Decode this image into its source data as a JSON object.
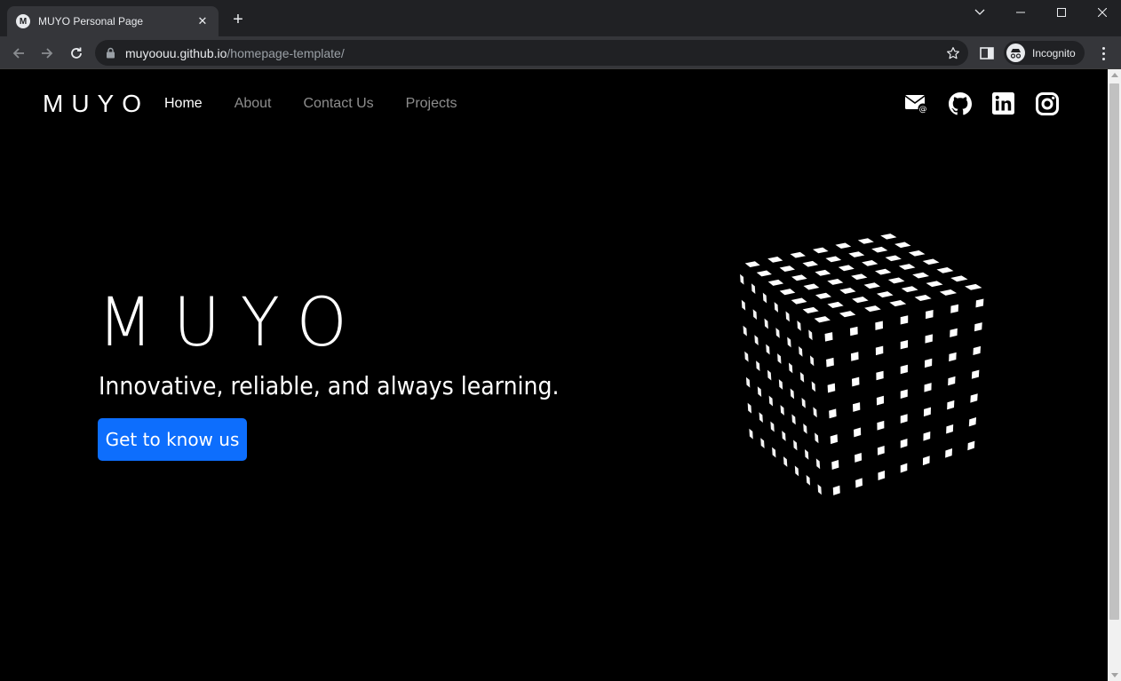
{
  "browser": {
    "tab_title": "MUYO Personal Page",
    "tab_favicon_letter": "M",
    "url_host": "muyoouu.github.io",
    "url_path": "/homepage-template/",
    "profile_label": "Incognito"
  },
  "site": {
    "brand": "MUYO",
    "nav": [
      {
        "label": "Home",
        "active": true
      },
      {
        "label": "About",
        "active": false
      },
      {
        "label": "Contact Us",
        "active": false
      },
      {
        "label": "Projects",
        "active": false
      }
    ],
    "social_icons": [
      "email-icon",
      "github-icon",
      "linkedin-icon",
      "instagram-icon"
    ]
  },
  "hero": {
    "title": "MUYO",
    "subtitle": "Innovative, reliable, and always learning.",
    "cta_label": "Get to know us"
  },
  "colors": {
    "background": "#000000",
    "primary": "#0d6efd",
    "nav_inactive": "#8c8c8c",
    "text": "#ffffff"
  }
}
